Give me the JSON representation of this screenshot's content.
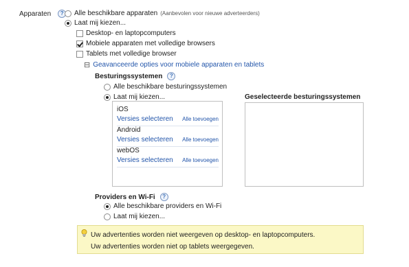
{
  "devices": {
    "label": "Apparaten",
    "help_glyph": "?",
    "option_all": {
      "label": "Alle beschikbare apparaten",
      "note": "(Aanbevolen voor nieuwe adverteerders)",
      "selected": false
    },
    "option_choose": {
      "label": "Laat mij kiezen...",
      "selected": true
    },
    "checkboxes": [
      {
        "label": "Desktop- en laptopcomputers",
        "checked": false
      },
      {
        "label": "Mobiele apparaten met volledige browsers",
        "checked": true
      },
      {
        "label": "Tablets met volledige browser",
        "checked": false
      }
    ],
    "advanced_toggle": {
      "symbol": "⊟",
      "label": "Geavanceerde opties voor mobiele apparaten en tablets"
    }
  },
  "os": {
    "heading": "Besturingssystemen",
    "option_all": {
      "label": "Alle beschikbare besturingssystemen",
      "selected": false
    },
    "option_choose": {
      "label": "Laat mij kiezen...",
      "selected": true
    },
    "items": [
      {
        "name": "iOS",
        "select_versions": "Versies selecteren",
        "add_all": "Alle toevoegen"
      },
      {
        "name": "Android",
        "select_versions": "Versies selecteren",
        "add_all": "Alle toevoegen"
      },
      {
        "name": "webOS",
        "select_versions": "Versies selecteren",
        "add_all": "Alle toevoegen"
      }
    ],
    "selected_heading": "Geselecteerde besturingssystemen"
  },
  "providers": {
    "heading": "Providers en Wi-Fi",
    "option_all": {
      "label": "Alle beschikbare providers en Wi-Fi",
      "selected": true
    },
    "option_choose": {
      "label": "Laat mij kiezen...",
      "selected": false
    }
  },
  "notice": {
    "lines": [
      "Uw advertenties worden niet weergeven op desktop- en laptopcomputers.",
      "Uw advertenties worden niet op tablets weergegeven."
    ]
  }
}
